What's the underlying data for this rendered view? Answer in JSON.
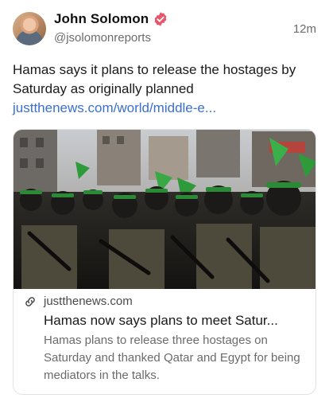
{
  "post": {
    "author_name": "John Solomon",
    "handle": "@jsolomonreports",
    "time": "12m",
    "text": "Hamas says it plans to release the hostages by Saturday as originally planned",
    "link": "justthenews.com/world/middle-e..."
  },
  "card": {
    "domain": "justthenews.com",
    "title": "Hamas now says plans to meet Satur...",
    "description": "Hamas plans to release three hostages on Saturday and thanked Qatar and Egypt for being mediators in the talks."
  },
  "icons": {
    "verified": "verified-badge-icon",
    "link": "link-icon"
  },
  "colors": {
    "verified": "#e8556a",
    "link": "#3b6fd0",
    "muted": "#6b6b6b"
  }
}
